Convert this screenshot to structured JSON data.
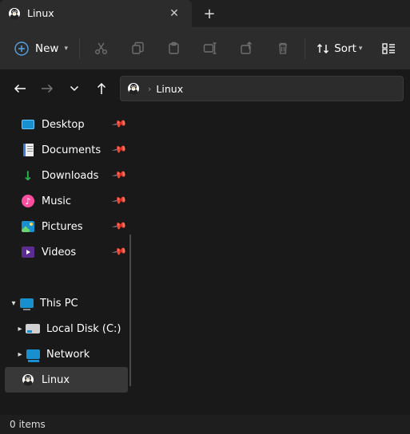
{
  "tab": {
    "title": "Linux"
  },
  "toolbar": {
    "new_label": "New",
    "sort_label": "Sort"
  },
  "breadcrumb": {
    "current": "Linux"
  },
  "sidebar": {
    "quick": [
      {
        "label": "Desktop"
      },
      {
        "label": "Documents"
      },
      {
        "label": "Downloads"
      },
      {
        "label": "Music"
      },
      {
        "label": "Pictures"
      },
      {
        "label": "Videos"
      }
    ],
    "this_pc": {
      "label": "This PC"
    },
    "local_disk": {
      "label": "Local Disk (C:)"
    },
    "network": {
      "label": "Network"
    },
    "linux": {
      "label": "Linux"
    }
  },
  "status": {
    "items": "0 items"
  }
}
